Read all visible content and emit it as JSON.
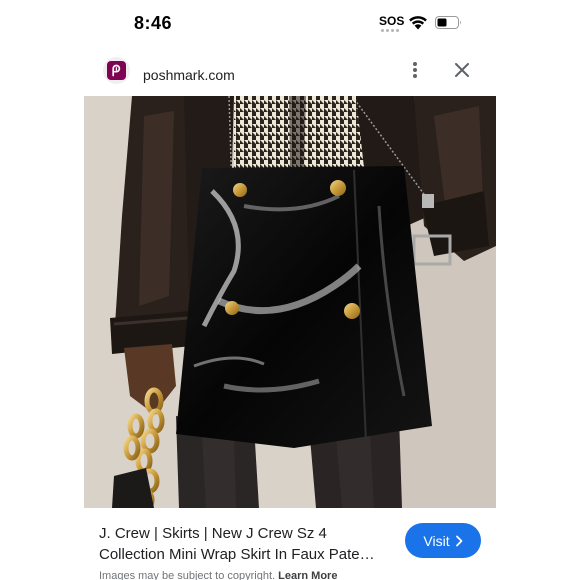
{
  "status_bar": {
    "time": "8:46",
    "sos_label": "SOS",
    "wifi_icon": "wifi-icon",
    "battery_icon": "battery-icon"
  },
  "header": {
    "site_icon": "poshmark-logo-icon",
    "domain": "poshmark.com",
    "more_icon": "more-vertical-icon",
    "close_icon": "close-icon"
  },
  "product": {
    "image_description_icon": "product-photo",
    "title_line1": "J. Crew | Skirts | New J Crew Sz 4",
    "title_line2": "Collection Mini Wrap Skirt In Faux Pate…",
    "visit_label": "Visit",
    "visit_icon": "chevron-right-icon"
  },
  "footer": {
    "copyright_text": "Images may be subject to copyright.",
    "learn_more": "Learn More"
  },
  "colors": {
    "brand": "#7f0353",
    "visit_button": "#1a73e8"
  }
}
